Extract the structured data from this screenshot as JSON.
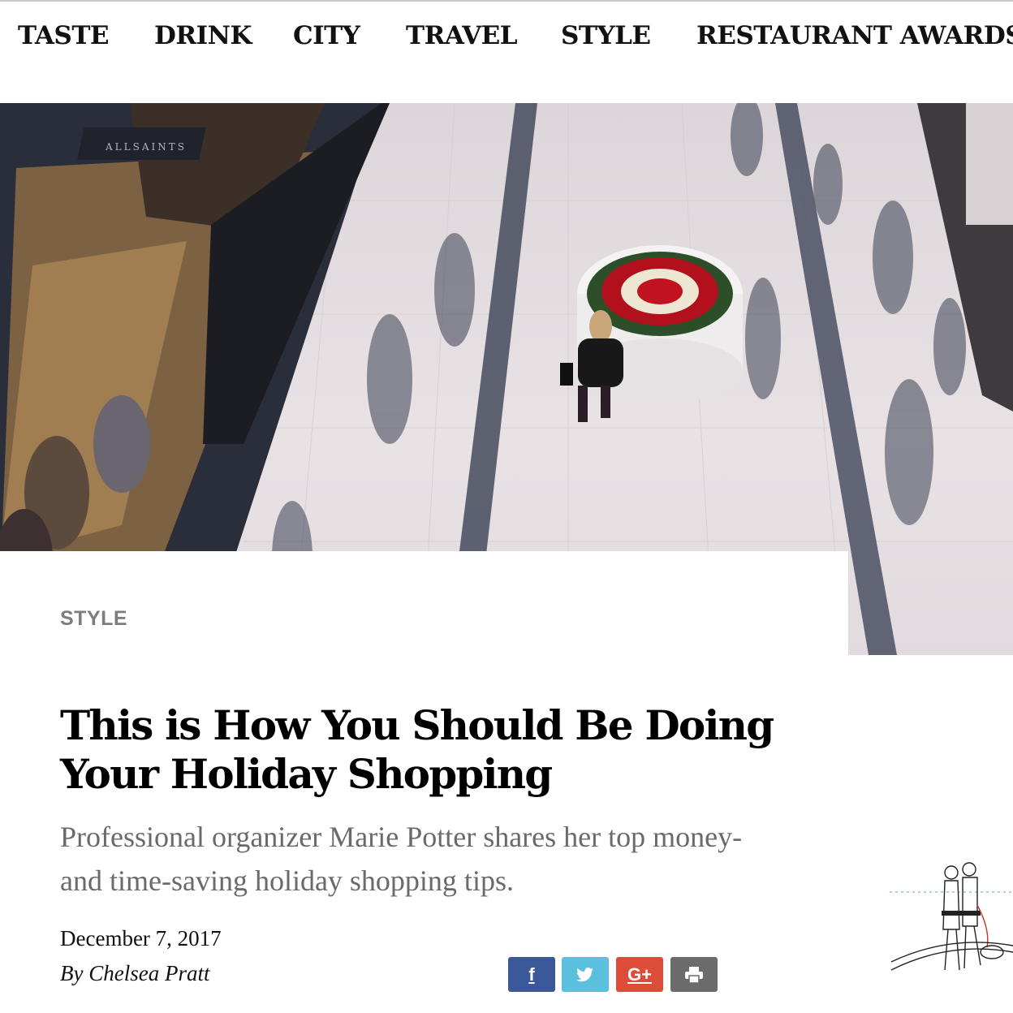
{
  "nav": {
    "items": [
      {
        "label": "TASTE"
      },
      {
        "label": "DRINK"
      },
      {
        "label": "CITY"
      },
      {
        "label": "TRAVEL"
      },
      {
        "label": "STYLE"
      },
      {
        "label": "RESTAURANT AWARDS"
      }
    ]
  },
  "hero": {
    "store_sign": "ALLSAINTS"
  },
  "article": {
    "category": "STYLE",
    "headline": "This is How You Should Be Doing Your Holiday Shopping",
    "dek": "Professional organizer Marie Potter shares her top money- and time-saving holiday shopping tips.",
    "date": "December 7, 2017",
    "byline": "By Chelsea Pratt"
  },
  "share": {
    "facebook": "f",
    "twitter": "twitter-bird",
    "googleplus": "G+",
    "print": "printer"
  },
  "colors": {
    "facebook": "#3b5998",
    "twitter": "#5bc0de",
    "googleplus": "#dd4b39",
    "print": "#6b6b6b",
    "kicker": "#7d7d7d",
    "dek": "#6a6a6a"
  }
}
